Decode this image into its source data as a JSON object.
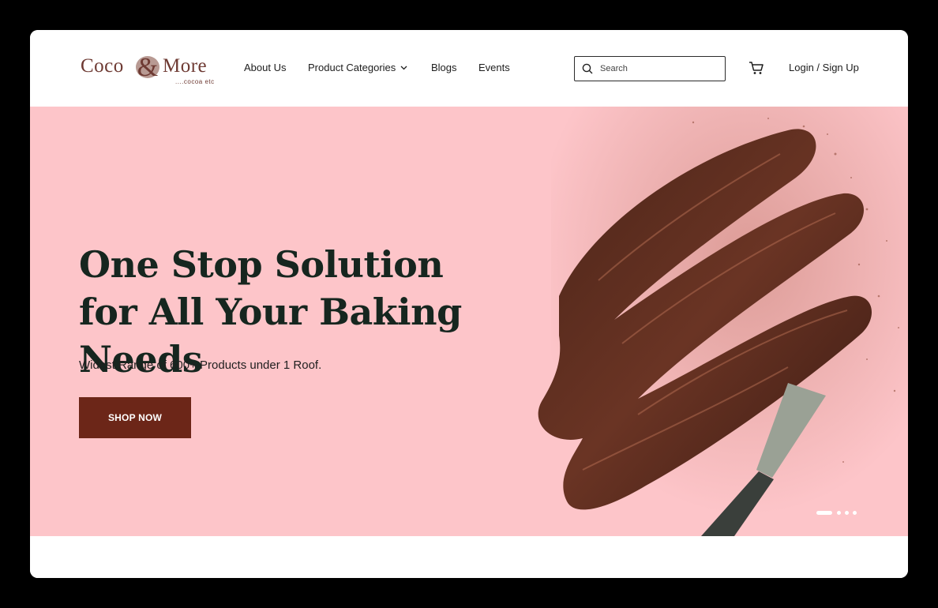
{
  "brand": {
    "word1": "Coco",
    "word2": "More",
    "tagline": "....cocoa etc"
  },
  "nav": {
    "items": [
      {
        "label": "About Us"
      },
      {
        "label": "Product Categories"
      },
      {
        "label": "Blogs"
      },
      {
        "label": "Events"
      }
    ],
    "search_placeholder": "Search",
    "login_label": "Login / Sign Up"
  },
  "hero": {
    "title": "One Stop Solution for All Your Baking Needs",
    "subtitle": "Widest Range of 600+ Products under 1 Roof.",
    "cta_label": "SHOP NOW",
    "slides_total": 4,
    "active_slide": 1
  },
  "colors": {
    "hero_bg": "#fdc5c9",
    "cta_bg": "#6c2618",
    "title_text": "#16261f",
    "logo": "#6e3a33"
  },
  "icons": [
    "search-icon",
    "cart-icon",
    "chevron-down-icon",
    "chocolate-spatula-image"
  ]
}
